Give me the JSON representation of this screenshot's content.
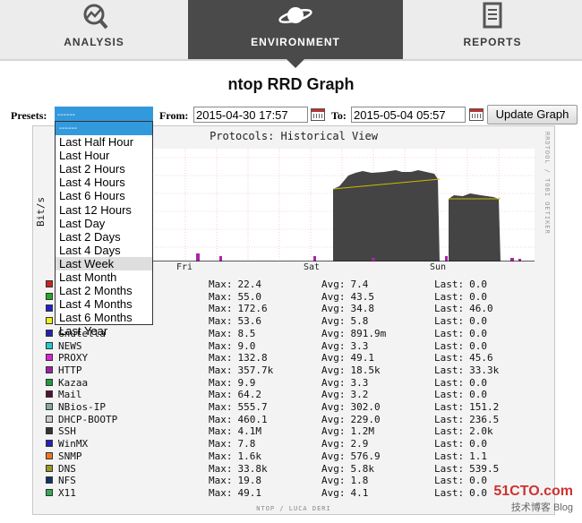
{
  "nav": {
    "items": [
      {
        "label": "ANALYSIS",
        "icon": "analysis-icon"
      },
      {
        "label": "ENVIRONMENT",
        "icon": "planet-icon",
        "active": true
      },
      {
        "label": "REPORTS",
        "icon": "reports-icon"
      }
    ]
  },
  "page": {
    "title": "ntop RRD Graph"
  },
  "controls": {
    "presets_label": "Presets:",
    "from_label": "From:",
    "from_value": "2015-04-30 17:57",
    "to_label": "To:",
    "to_value": "2015-05-04 05:57",
    "update_button": "Update Graph"
  },
  "presets": {
    "selected": "------",
    "options": [
      "------",
      "Last Half Hour",
      "Last Hour",
      "Last 2 Hours",
      "Last 4 Hours",
      "Last 6 Hours",
      "Last 12 Hours",
      "Last Day",
      "Last 2 Days",
      "Last 4 Days",
      "Last Week",
      "Last Month",
      "Last 2 Months",
      "Last 4 Months",
      "Last 6 Months",
      "Last Year"
    ],
    "hovered": "Last Week"
  },
  "graph": {
    "title": "Protocols: Historical View",
    "ylabel": "Bit/s",
    "side_text": "RRDTOOL / TOBI OETIKER",
    "footer": "NTOP / LUCA DERI",
    "x_ticks": [
      "Fri",
      "Sat",
      "Sun"
    ],
    "legend": [
      {
        "name": "",
        "color": "#cc2222",
        "max": "22.4",
        "avg": "7.4",
        "last": "0.0"
      },
      {
        "name": "",
        "color": "#22aa22",
        "max": "55.0",
        "avg": "43.5",
        "last": "0.0"
      },
      {
        "name": "",
        "color": "#2222cc",
        "max": "172.6",
        "avg": "34.8",
        "last": "46.0"
      },
      {
        "name": "",
        "color": "#eeee22",
        "max": "53.6",
        "avg": "5.8",
        "last": "0.0"
      },
      {
        "name": "Gnutella",
        "color": "#2222aa",
        "max": "8.5",
        "avg": "891.9m",
        "last": "0.0"
      },
      {
        "name": "NEWS",
        "color": "#22cccc",
        "max": "9.0",
        "avg": "3.3",
        "last": "0.0"
      },
      {
        "name": "PROXY",
        "color": "#dd22dd",
        "max": "132.8",
        "avg": "49.1",
        "last": "45.6"
      },
      {
        "name": "HTTP",
        "color": "#9922aa",
        "max": "357.7k",
        "avg": "18.5k",
        "last": "33.3k"
      },
      {
        "name": "Kazaa",
        "color": "#229944",
        "max": "9.9",
        "avg": "3.3",
        "last": "0.0"
      },
      {
        "name": "Mail",
        "color": "#551133",
        "max": "64.2",
        "avg": "3.2",
        "last": "0.0"
      },
      {
        "name": "NBios-IP",
        "color": "#88aa99",
        "max": "555.7",
        "avg": "302.0",
        "last": "151.2"
      },
      {
        "name": "DHCP-BOOTP",
        "color": "#cccccc",
        "max": "460.1",
        "avg": "229.0",
        "last": "236.5"
      },
      {
        "name": "SSH",
        "color": "#333333",
        "max": "4.1M",
        "avg": "1.2M",
        "last": "2.0k"
      },
      {
        "name": "WinMX",
        "color": "#2222bb",
        "max": "7.8",
        "avg": "2.9",
        "last": "0.0"
      },
      {
        "name": "SNMP",
        "color": "#ee7722",
        "max": "1.6k",
        "avg": "576.9",
        "last": "1.1"
      },
      {
        "name": "DNS",
        "color": "#999922",
        "max": "33.8k",
        "avg": "5.8k",
        "last": "539.5"
      },
      {
        "name": "NFS",
        "color": "#113366",
        "max": "19.8",
        "avg": "1.8",
        "last": "0.0"
      },
      {
        "name": "X11",
        "color": "#33aa55",
        "max": "49.1",
        "avg": "4.1",
        "last": "0.0"
      }
    ],
    "labels": {
      "max": "Max:",
      "avg": "Avg:",
      "last": "Last:"
    }
  },
  "watermark": {
    "line1": "51CTO.com",
    "line2": "技术博客",
    "line3": "Blog"
  }
}
